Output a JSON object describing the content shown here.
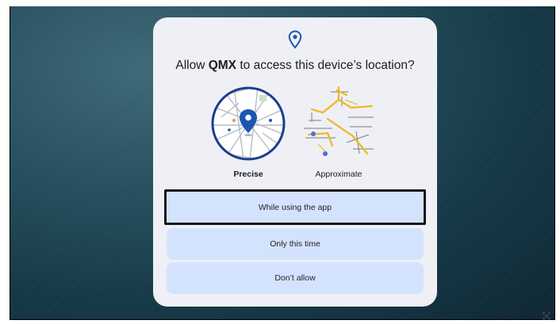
{
  "dialog": {
    "title_prefix": "Allow ",
    "app_name": "QMX",
    "title_suffix": " to access this device’s location?",
    "options": {
      "precise_label": "Precise",
      "approximate_label": "Approximate"
    },
    "buttons": {
      "while_using": "While using the app",
      "only_this_time": "Only this time",
      "dont_allow": "Don’t allow"
    }
  },
  "icons": {
    "header": "location-pin-icon",
    "precise_map": "precise-map-icon",
    "approximate_map": "approximate-map-icon",
    "corner": "screenshot-icon"
  },
  "colors": {
    "accent": "#1a57b3",
    "button_bg": "#d4e3fd",
    "dialog_bg": "#eef0f5",
    "map_road": "#f3b61d"
  }
}
